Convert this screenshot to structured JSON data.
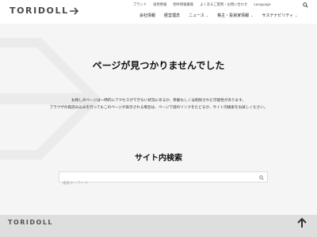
{
  "header": {
    "logo_text": "TORIDOLL",
    "util_nav": [
      "ブランド",
      "採用情報",
      "物件情報募集",
      "よくあるご質問・お問い合わせ",
      "Language"
    ],
    "main_nav": [
      {
        "label": "会社情報",
        "dropdown": false
      },
      {
        "label": "経営理念",
        "dropdown": false
      },
      {
        "label": "ニュース",
        "dropdown": true
      },
      {
        "label": "株主・投資家情報",
        "dropdown": true
      },
      {
        "label": "サステナビリティ",
        "dropdown": true
      }
    ]
  },
  "main": {
    "heading": "ページが見つかりませんでした",
    "message_line1": "お探しのページは一時的にアクセスができない状況にあるか、移動もしくは削除された可能性があります。",
    "message_line2": "ブラウザの再読み込みを行ってもこのページが表示される場合は、ページ下部のリンクをたどるか、サイト内検索をお試しください。"
  },
  "search": {
    "heading": "サイト内検索",
    "placeholder": "検索キーワード"
  },
  "footer": {
    "logo_text": "TORIDOLL"
  },
  "colors": {
    "background": "#f5f5f5",
    "arrow_graphic": "#ebebeb",
    "footer": "#dedede"
  }
}
